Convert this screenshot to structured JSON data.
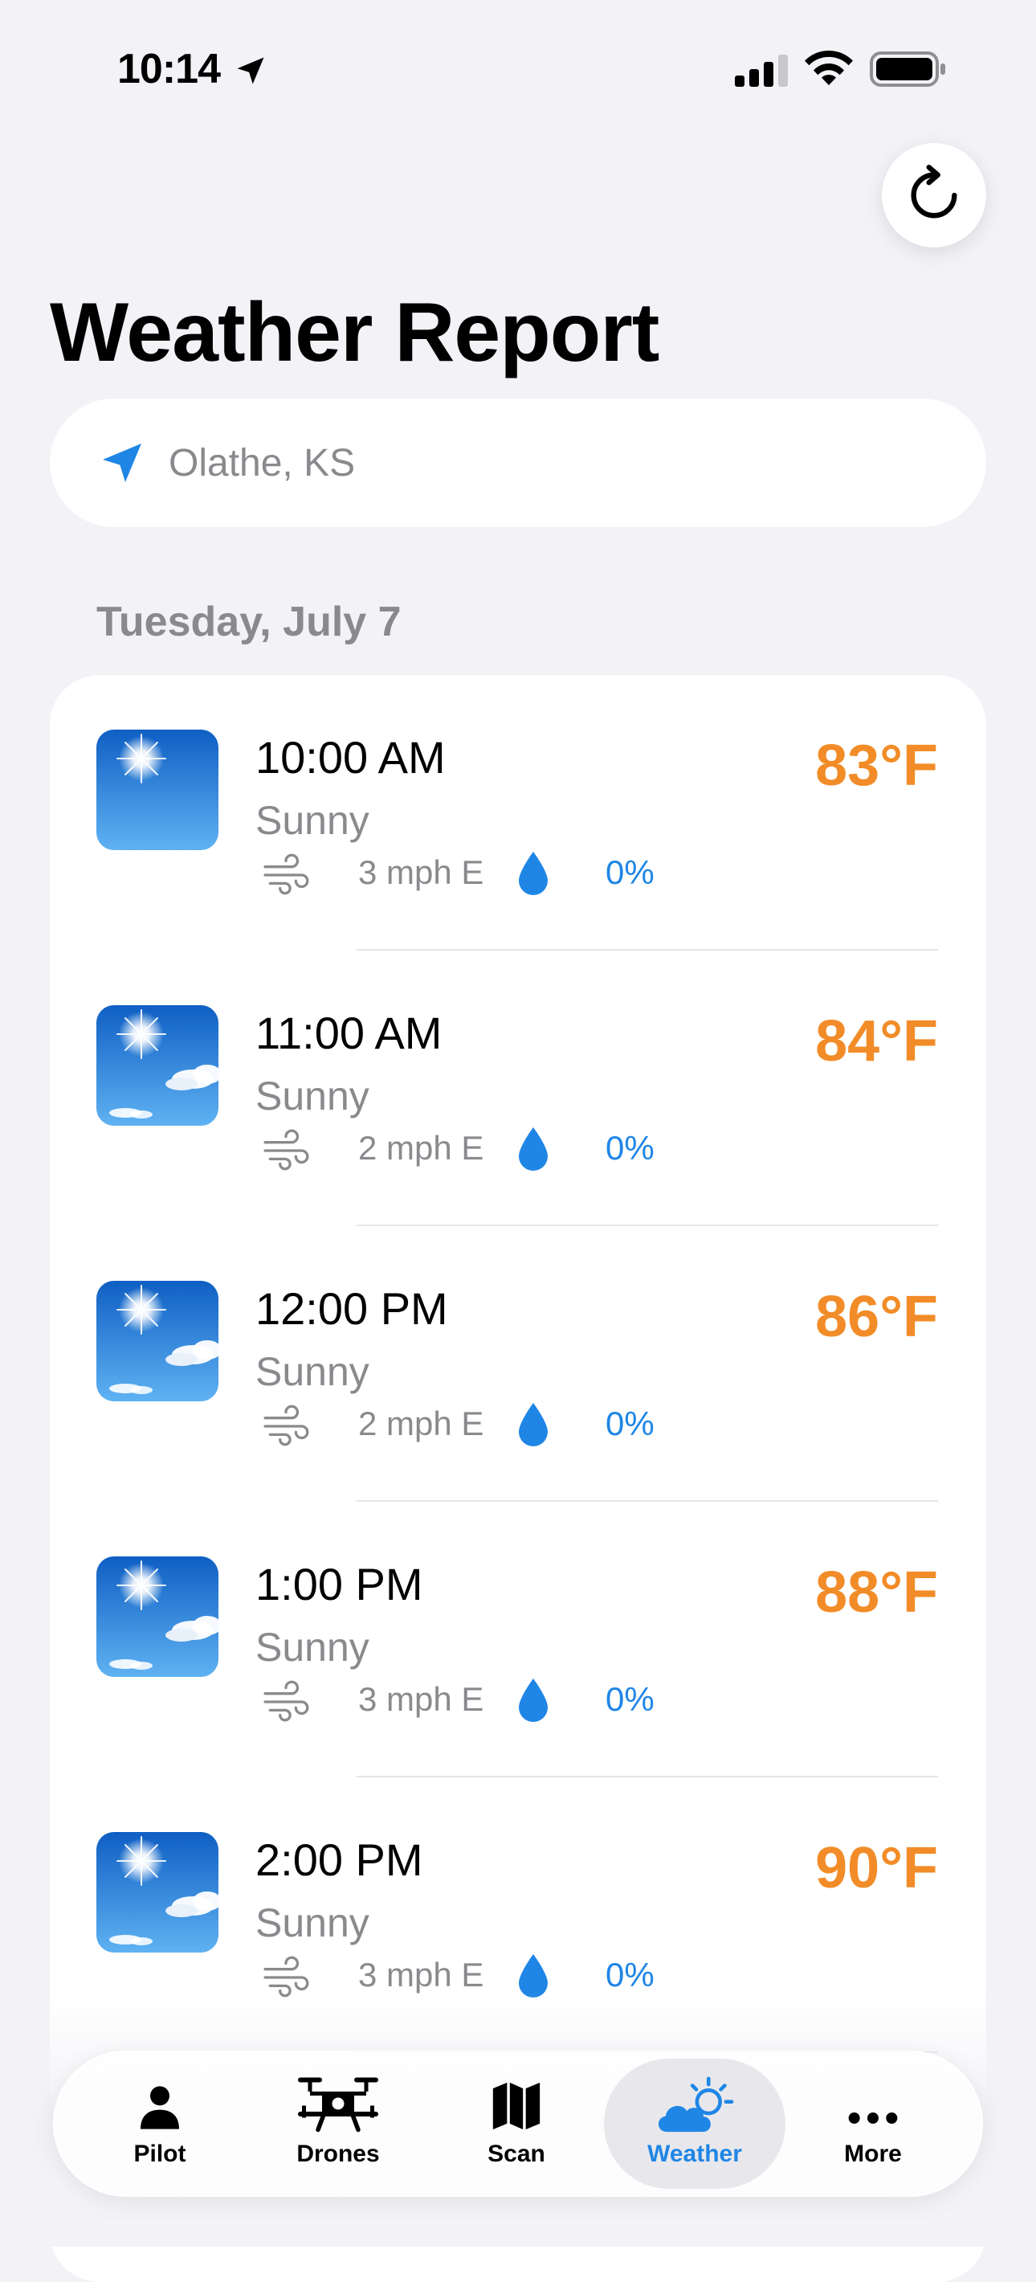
{
  "status_bar": {
    "time": "10:14",
    "icons": [
      "location-arrow-icon",
      "cellular-signal-icon",
      "wifi-icon",
      "battery-icon"
    ]
  },
  "header": {
    "title": "Weather Report",
    "refresh_icon": "refresh-icon"
  },
  "location": {
    "value": "Olathe, KS",
    "icon": "location-arrow-icon",
    "accent": "#1f86e6"
  },
  "forecast": {
    "date": "Tuesday, July 7",
    "hours": [
      {
        "time": "10:00 AM",
        "condition": "Sunny",
        "wind": "3 mph E",
        "precip": "0%",
        "temp": "83°F",
        "icon": "sunny-icon"
      },
      {
        "time": "11:00 AM",
        "condition": "Sunny",
        "wind": "2 mph E",
        "precip": "0%",
        "temp": "84°F",
        "icon": "sunny-cloud-icon"
      },
      {
        "time": "12:00 PM",
        "condition": "Sunny",
        "wind": "2 mph E",
        "precip": "0%",
        "temp": "86°F",
        "icon": "sunny-cloud-icon"
      },
      {
        "time": "1:00 PM",
        "condition": "Sunny",
        "wind": "3 mph E",
        "precip": "0%",
        "temp": "88°F",
        "icon": "sunny-cloud-icon"
      },
      {
        "time": "2:00 PM",
        "condition": "Sunny",
        "wind": "3 mph E",
        "precip": "0%",
        "temp": "90°F",
        "icon": "sunny-cloud-icon"
      }
    ],
    "temp_color": "#f28c28",
    "precip_color": "#1f86e6"
  },
  "tab_bar": {
    "tabs": [
      {
        "label": "Pilot",
        "icon": "person-icon",
        "active": false
      },
      {
        "label": "Drones",
        "icon": "drone-icon",
        "active": false
      },
      {
        "label": "Scan",
        "icon": "map-icon",
        "active": false
      },
      {
        "label": "Weather",
        "icon": "cloud-sun-icon",
        "active": true
      },
      {
        "label": "More",
        "icon": "ellipsis-icon",
        "active": false
      }
    ]
  }
}
